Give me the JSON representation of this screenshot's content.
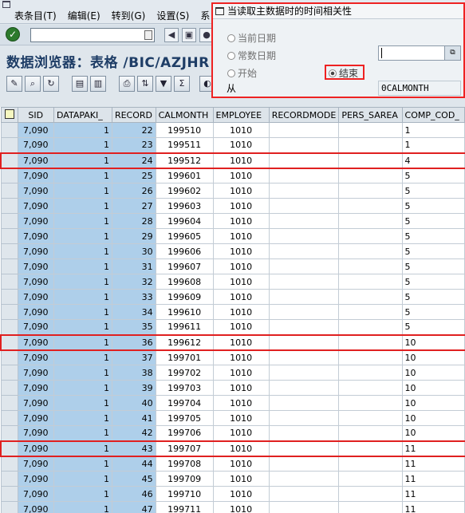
{
  "menu": {
    "items": [
      "表条目(T)",
      "编辑(E)",
      "转到(G)",
      "设置(S)",
      "系"
    ]
  },
  "title": "数据浏览器：表格 /BIC/AZJHR",
  "popup": {
    "title": "当读取主数据时的时间相关性",
    "radio_current_date": "当前日期",
    "radio_constant_date": "常数日期",
    "radio_start": "开始",
    "radio_end": "结束",
    "from_label": "从",
    "from_value": "0CALMONTH",
    "selected": "结束"
  },
  "table": {
    "columns": [
      "SID",
      "DATAPAKI_",
      "RECORD",
      "CALMONTH",
      "EMPLOYEE",
      "RECORDMODE",
      "PERS_SAREA",
      "COMP_COD_"
    ],
    "rows": [
      {
        "sid": "7,090",
        "datapak": "1",
        "record": "22",
        "calmonth": "199510",
        "employee": "1010",
        "recordmode": "",
        "pers_sarea": "",
        "comp_code": "1",
        "hl": false
      },
      {
        "sid": "7,090",
        "datapak": "1",
        "record": "23",
        "calmonth": "199511",
        "employee": "1010",
        "recordmode": "",
        "pers_sarea": "",
        "comp_code": "1",
        "hl": false
      },
      {
        "sid": "7,090",
        "datapak": "1",
        "record": "24",
        "calmonth": "199512",
        "employee": "1010",
        "recordmode": "",
        "pers_sarea": "",
        "comp_code": "4",
        "hl": true
      },
      {
        "sid": "7,090",
        "datapak": "1",
        "record": "25",
        "calmonth": "199601",
        "employee": "1010",
        "recordmode": "",
        "pers_sarea": "",
        "comp_code": "5",
        "hl": false
      },
      {
        "sid": "7,090",
        "datapak": "1",
        "record": "26",
        "calmonth": "199602",
        "employee": "1010",
        "recordmode": "",
        "pers_sarea": "",
        "comp_code": "5",
        "hl": false
      },
      {
        "sid": "7,090",
        "datapak": "1",
        "record": "27",
        "calmonth": "199603",
        "employee": "1010",
        "recordmode": "",
        "pers_sarea": "",
        "comp_code": "5",
        "hl": false
      },
      {
        "sid": "7,090",
        "datapak": "1",
        "record": "28",
        "calmonth": "199604",
        "employee": "1010",
        "recordmode": "",
        "pers_sarea": "",
        "comp_code": "5",
        "hl": false
      },
      {
        "sid": "7,090",
        "datapak": "1",
        "record": "29",
        "calmonth": "199605",
        "employee": "1010",
        "recordmode": "",
        "pers_sarea": "",
        "comp_code": "5",
        "hl": false
      },
      {
        "sid": "7,090",
        "datapak": "1",
        "record": "30",
        "calmonth": "199606",
        "employee": "1010",
        "recordmode": "",
        "pers_sarea": "",
        "comp_code": "5",
        "hl": false
      },
      {
        "sid": "7,090",
        "datapak": "1",
        "record": "31",
        "calmonth": "199607",
        "employee": "1010",
        "recordmode": "",
        "pers_sarea": "",
        "comp_code": "5",
        "hl": false
      },
      {
        "sid": "7,090",
        "datapak": "1",
        "record": "32",
        "calmonth": "199608",
        "employee": "1010",
        "recordmode": "",
        "pers_sarea": "",
        "comp_code": "5",
        "hl": false
      },
      {
        "sid": "7,090",
        "datapak": "1",
        "record": "33",
        "calmonth": "199609",
        "employee": "1010",
        "recordmode": "",
        "pers_sarea": "",
        "comp_code": "5",
        "hl": false
      },
      {
        "sid": "7,090",
        "datapak": "1",
        "record": "34",
        "calmonth": "199610",
        "employee": "1010",
        "recordmode": "",
        "pers_sarea": "",
        "comp_code": "5",
        "hl": false
      },
      {
        "sid": "7,090",
        "datapak": "1",
        "record": "35",
        "calmonth": "199611",
        "employee": "1010",
        "recordmode": "",
        "pers_sarea": "",
        "comp_code": "5",
        "hl": false
      },
      {
        "sid": "7,090",
        "datapak": "1",
        "record": "36",
        "calmonth": "199612",
        "employee": "1010",
        "recordmode": "",
        "pers_sarea": "",
        "comp_code": "10",
        "hl": true
      },
      {
        "sid": "7,090",
        "datapak": "1",
        "record": "37",
        "calmonth": "199701",
        "employee": "1010",
        "recordmode": "",
        "pers_sarea": "",
        "comp_code": "10",
        "hl": false
      },
      {
        "sid": "7,090",
        "datapak": "1",
        "record": "38",
        "calmonth": "199702",
        "employee": "1010",
        "recordmode": "",
        "pers_sarea": "",
        "comp_code": "10",
        "hl": false
      },
      {
        "sid": "7,090",
        "datapak": "1",
        "record": "39",
        "calmonth": "199703",
        "employee": "1010",
        "recordmode": "",
        "pers_sarea": "",
        "comp_code": "10",
        "hl": false
      },
      {
        "sid": "7,090",
        "datapak": "1",
        "record": "40",
        "calmonth": "199704",
        "employee": "1010",
        "recordmode": "",
        "pers_sarea": "",
        "comp_code": "10",
        "hl": false
      },
      {
        "sid": "7,090",
        "datapak": "1",
        "record": "41",
        "calmonth": "199705",
        "employee": "1010",
        "recordmode": "",
        "pers_sarea": "",
        "comp_code": "10",
        "hl": false
      },
      {
        "sid": "7,090",
        "datapak": "1",
        "record": "42",
        "calmonth": "199706",
        "employee": "1010",
        "recordmode": "",
        "pers_sarea": "",
        "comp_code": "10",
        "hl": false
      },
      {
        "sid": "7,090",
        "datapak": "1",
        "record": "43",
        "calmonth": "199707",
        "employee": "1010",
        "recordmode": "",
        "pers_sarea": "",
        "comp_code": "11",
        "hl": true
      },
      {
        "sid": "7,090",
        "datapak": "1",
        "record": "44",
        "calmonth": "199708",
        "employee": "1010",
        "recordmode": "",
        "pers_sarea": "",
        "comp_code": "11",
        "hl": false
      },
      {
        "sid": "7,090",
        "datapak": "1",
        "record": "45",
        "calmonth": "199709",
        "employee": "1010",
        "recordmode": "",
        "pers_sarea": "",
        "comp_code": "11",
        "hl": false
      },
      {
        "sid": "7,090",
        "datapak": "1",
        "record": "46",
        "calmonth": "199710",
        "employee": "1010",
        "recordmode": "",
        "pers_sarea": "",
        "comp_code": "11",
        "hl": false
      },
      {
        "sid": "7,090",
        "datapak": "1",
        "record": "47",
        "calmonth": "199711",
        "employee": "1010",
        "recordmode": "",
        "pers_sarea": "",
        "comp_code": "11",
        "hl": false
      }
    ]
  },
  "colors": {
    "highlight": "#e02020",
    "key_column": "#aecfea",
    "title": "#1e3d66"
  }
}
